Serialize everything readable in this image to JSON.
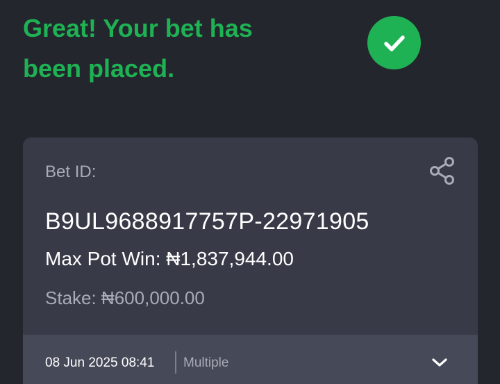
{
  "confirmation": {
    "headline": "Great! Your bet has been placed.",
    "icon": "check-circle-icon",
    "accent_color": "#1fb254"
  },
  "bet_card": {
    "bet_id_label": "Bet ID:",
    "bet_id": "B9UL9688917757P-22971905",
    "max_pot_win": "Max Pot Win: ₦1,837,944.00",
    "stake": "Stake: ₦600,000.00",
    "share_icon": "share-icon",
    "footer": {
      "date_time": "08 Jun 2025 08:41",
      "bet_type": "Multiple",
      "expand_icon": "chevron-down-icon"
    }
  },
  "colors": {
    "background": "#23262c",
    "card": "#383a47",
    "card_footer": "#464957",
    "muted_text": "#a9abb6"
  }
}
